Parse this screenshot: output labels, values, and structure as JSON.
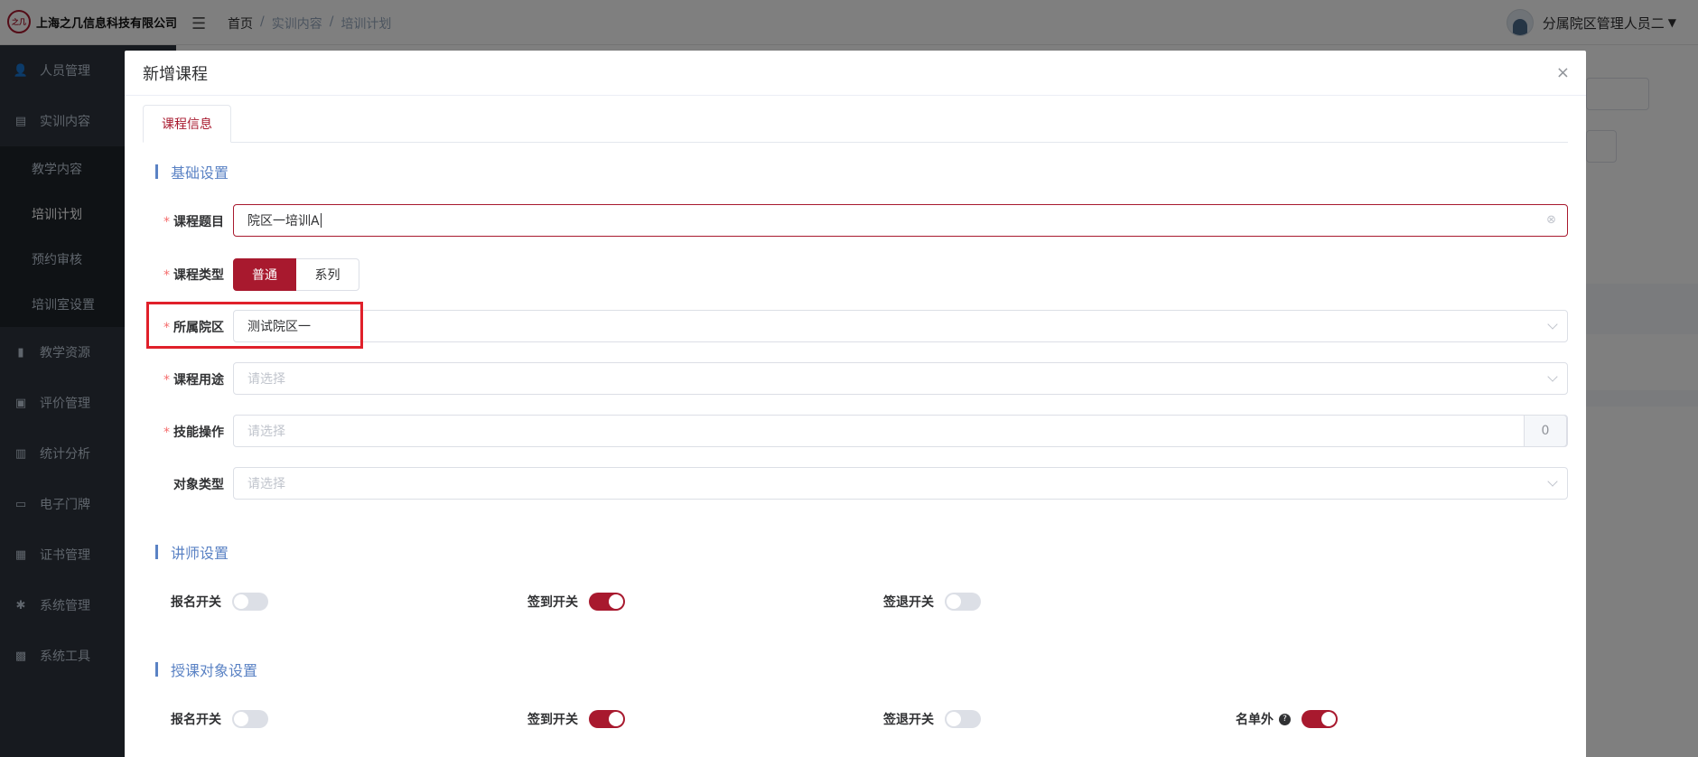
{
  "app": {
    "company": "上海之几信息科技有限公司",
    "logo_mark": "之几"
  },
  "breadcrumb": [
    "首页",
    "/",
    "实训内容",
    "/",
    "培训计划"
  ],
  "user": {
    "name": "分属院区管理人员二"
  },
  "sidebar": {
    "items": [
      {
        "label": "人员管理",
        "icon": "user-icon"
      },
      {
        "label": "实训内容",
        "icon": "document-icon"
      },
      {
        "label": "教学资源",
        "icon": "book-icon"
      },
      {
        "label": "评价管理",
        "icon": "image-icon"
      },
      {
        "label": "统计分析",
        "icon": "bar-chart-icon"
      },
      {
        "label": "电子门牌",
        "icon": "monitor-icon"
      },
      {
        "label": "证书管理",
        "icon": "briefcase-icon"
      },
      {
        "label": "系统管理",
        "icon": "gear-icon"
      },
      {
        "label": "系统工具",
        "icon": "toolbox-icon"
      }
    ],
    "subitems": [
      "教学内容",
      "培训计划",
      "预约审核",
      "培训室设置"
    ]
  },
  "dialog": {
    "title": "新增课程",
    "close": "×",
    "tab": "课程信息",
    "sections": {
      "basic": "基础设置",
      "teacher": "讲师设置",
      "target": "授课对象设置"
    },
    "fields": {
      "course_title": {
        "label": "课程题目",
        "value": "院区一培训A"
      },
      "course_type": {
        "label": "课程类型",
        "options": [
          "普通",
          "系列"
        ],
        "selected": "普通"
      },
      "campus": {
        "label": "所属院区",
        "value": "测试院区一"
      },
      "purpose": {
        "label": "课程用途",
        "placeholder": "请选择"
      },
      "skill": {
        "label": "技能操作",
        "placeholder": "请选择",
        "count": "0"
      },
      "object_type": {
        "label": "对象类型",
        "placeholder": "请选择"
      }
    },
    "required_mark": "*",
    "teacher_switches": [
      {
        "label": "报名开关",
        "on": false
      },
      {
        "label": "签到开关",
        "on": true
      },
      {
        "label": "签退开关",
        "on": false
      }
    ],
    "target_switches": [
      {
        "label": "报名开关",
        "on": false
      },
      {
        "label": "签到开关",
        "on": true
      },
      {
        "label": "签退开关",
        "on": false
      },
      {
        "label": "名单外",
        "on": true,
        "help": "?"
      }
    ]
  },
  "colors": {
    "accent": "#a8192e",
    "section": "#5a82c4",
    "sidebar": "#2f353e"
  }
}
